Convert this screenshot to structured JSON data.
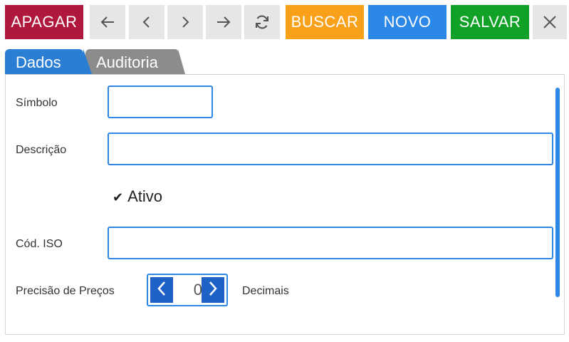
{
  "toolbar": {
    "apagar": "APAGAR",
    "buscar": "BUSCAR",
    "novo": "NOVO",
    "salvar": "SALVAR",
    "icons": [
      "arrow-left-icon",
      "chevron-left-icon",
      "chevron-right-icon",
      "arrow-right-icon",
      "refresh-icon",
      "close-icon"
    ],
    "colors": {
      "apagar": "#b0173c",
      "buscar": "#f9a11a",
      "novo": "#2b87e8",
      "salvar": "#10a126",
      "nav_bg": "#e6e6e6"
    }
  },
  "tabs": [
    {
      "label": "Dados",
      "active": true,
      "color": "#2a7fd4"
    },
    {
      "label": "Auditoria",
      "active": false,
      "color": "#8c8c8c"
    }
  ],
  "form": {
    "simbolo": {
      "label": "Símbolo",
      "value": ""
    },
    "descricao": {
      "label": "Descrição",
      "value": ""
    },
    "ativo": {
      "label": "Ativo",
      "checked": true
    },
    "cod_iso": {
      "label": "Cód. ISO",
      "value": ""
    },
    "precisao": {
      "label": "Precisão de Preços",
      "value": "0",
      "suffix": "Decimais"
    }
  },
  "accent_color": "#2c87e6"
}
